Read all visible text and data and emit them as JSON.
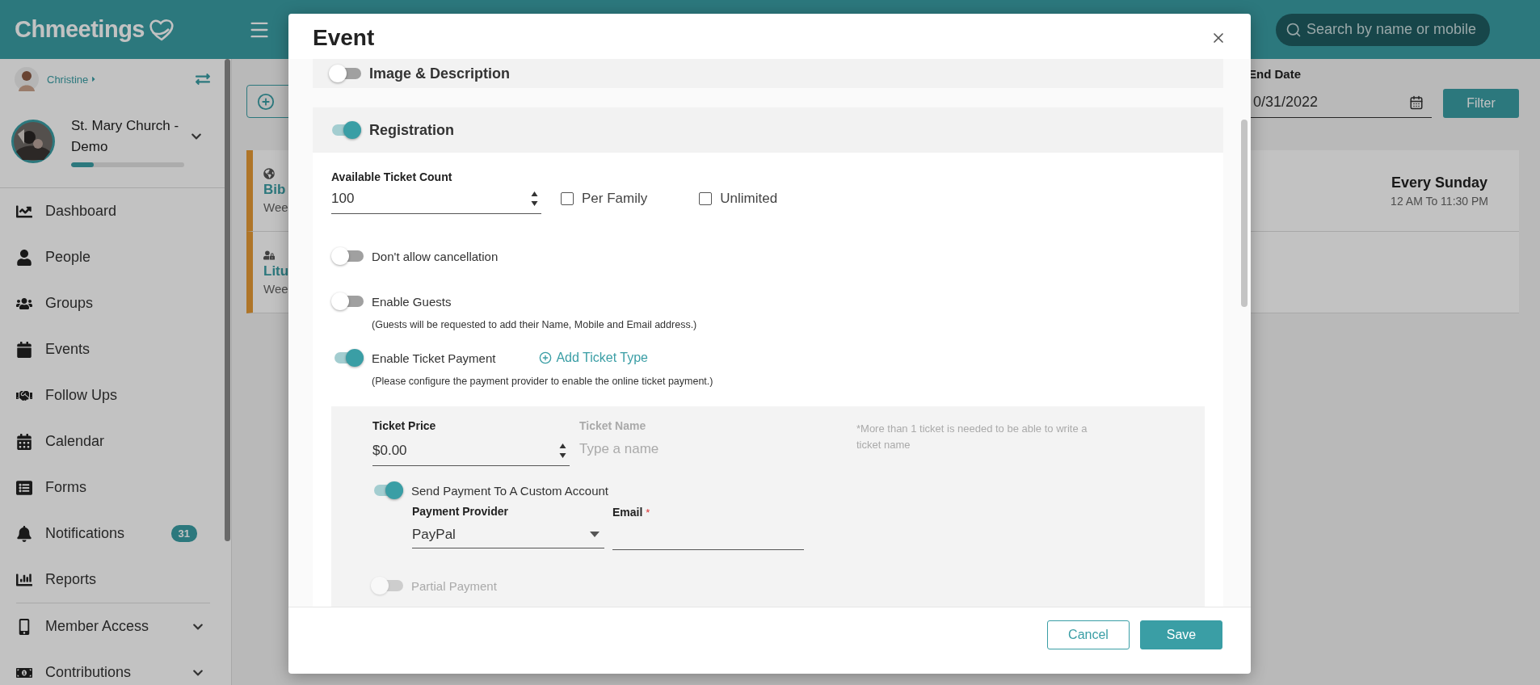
{
  "header": {
    "logo": "Chmeetings",
    "search": {
      "placeholder": "Search by name or mobile"
    }
  },
  "sidebar": {
    "user": "Christine",
    "church": "St. Mary Church - Demo",
    "setup_progress": {
      "level": 0.2
    },
    "items": [
      {
        "label": "Dashboard"
      },
      {
        "label": "People"
      },
      {
        "label": "Groups"
      },
      {
        "label": "Events"
      },
      {
        "label": "Follow Ups"
      },
      {
        "label": "Calendar"
      },
      {
        "label": "Forms"
      },
      {
        "label": "Notifications",
        "badge": "31"
      },
      {
        "label": "Reports"
      },
      {
        "label": "Member Access",
        "expanded": false
      },
      {
        "label": "Contributions",
        "expanded": false
      }
    ]
  },
  "events_page": {
    "filter": {
      "end_date_label": "End Date",
      "end_date": "0/31/2022",
      "button": "Filter"
    },
    "events": [
      {
        "title": "Bib",
        "subtitle": "Wee",
        "schedule": "Every Sunday",
        "time": "12 AM To 11:30 PM"
      },
      {
        "title": "Litu",
        "subtitle": "Wee"
      }
    ]
  },
  "modal": {
    "title": "Event",
    "sections": [
      {
        "title": "Image & Description",
        "on": false
      },
      {
        "title": "Registration",
        "on": true
      }
    ],
    "registration": {
      "ticket_count": {
        "label": "Available Ticket Count",
        "value": "100"
      },
      "checkboxes": [
        {
          "label": "Per Family",
          "checked": false
        },
        {
          "label": "Unlimited",
          "checked": false
        }
      ],
      "settings": [
        {
          "label": "Don't allow cancellation",
          "on": false
        },
        {
          "label": "Enable Guests",
          "on": false,
          "note": "(Guests will be requested to add their Name, Mobile and Email address.)"
        },
        {
          "label": "Enable Ticket Payment",
          "on": true,
          "link": "Add Ticket Type",
          "note": "(Please configure the payment provider to enable the online ticket payment.)"
        }
      ],
      "ticket": {
        "price": {
          "label": "Ticket Price",
          "value": "$0.00"
        },
        "name": {
          "label": "Ticket Name",
          "placeholder": "Type a name",
          "disabled": true
        },
        "hint": "*More than 1 ticket is needed to be able to write a ticket name",
        "custom_account": {
          "label": "Send Payment To A Custom Account",
          "on": true
        },
        "provider": {
          "label": "Payment Provider",
          "value": "PayPal"
        },
        "email": {
          "label": "Email",
          "required_mark": "*"
        },
        "partial_payment": {
          "label": "Partial Payment",
          "on": false,
          "disabled": true
        }
      }
    },
    "buttons": [
      {
        "label": "Cancel",
        "kind": "secondary"
      },
      {
        "label": "Save",
        "kind": "primary"
      }
    ]
  }
}
